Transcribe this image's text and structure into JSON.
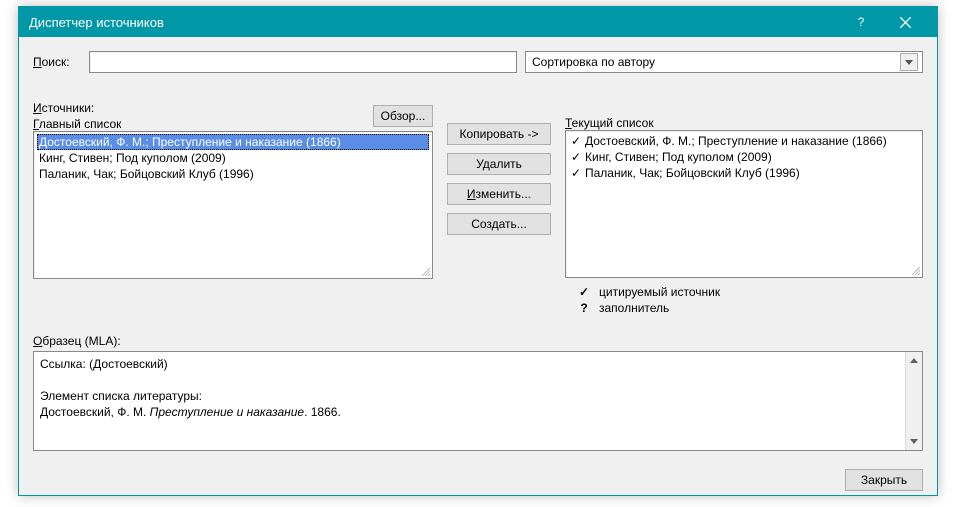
{
  "titlebar": {
    "title": "Диспетчер источников"
  },
  "search": {
    "label": "Поиск:",
    "value": ""
  },
  "sort": {
    "selected": "Сортировка по автору"
  },
  "sources": {
    "label": "Источники:",
    "browse": "Обзор...",
    "master": {
      "label": "Главный список",
      "items": [
        {
          "text": "Достоевский, Ф. М.; Преступление и наказание (1866)",
          "selected": true
        },
        {
          "text": "Кинг, Стивен; Под куполом (2009)",
          "selected": false
        },
        {
          "text": "Паланик, Чак; Бойцовский Клуб (1996)",
          "selected": false
        }
      ]
    },
    "current": {
      "label": "Текущий список",
      "items": [
        {
          "text": "Достоевский, Ф. М.; Преступление и наказание (1866)",
          "check": true
        },
        {
          "text": "Кинг, Стивен; Под куполом (2009)",
          "check": true
        },
        {
          "text": "Паланик, Чак; Бойцовский Клуб (1996)",
          "check": true
        }
      ]
    }
  },
  "actions": {
    "copy": "Копировать ->",
    "delete": "Удалить",
    "edit": "Изменить...",
    "create": "Создать..."
  },
  "legend": {
    "cited": "цитируемый источник",
    "placeholder": "заполнитель"
  },
  "preview": {
    "label": "Образец (MLA):",
    "link_prefix": "Ссылка:  (Достоевский)",
    "biblio_label": "Элемент списка литературы:",
    "biblio_author": "Достоевский, Ф. М. ",
    "biblio_title_italic": "Преступление и наказание",
    "biblio_suffix": ". 1866."
  },
  "footer": {
    "close": "Закрыть"
  }
}
